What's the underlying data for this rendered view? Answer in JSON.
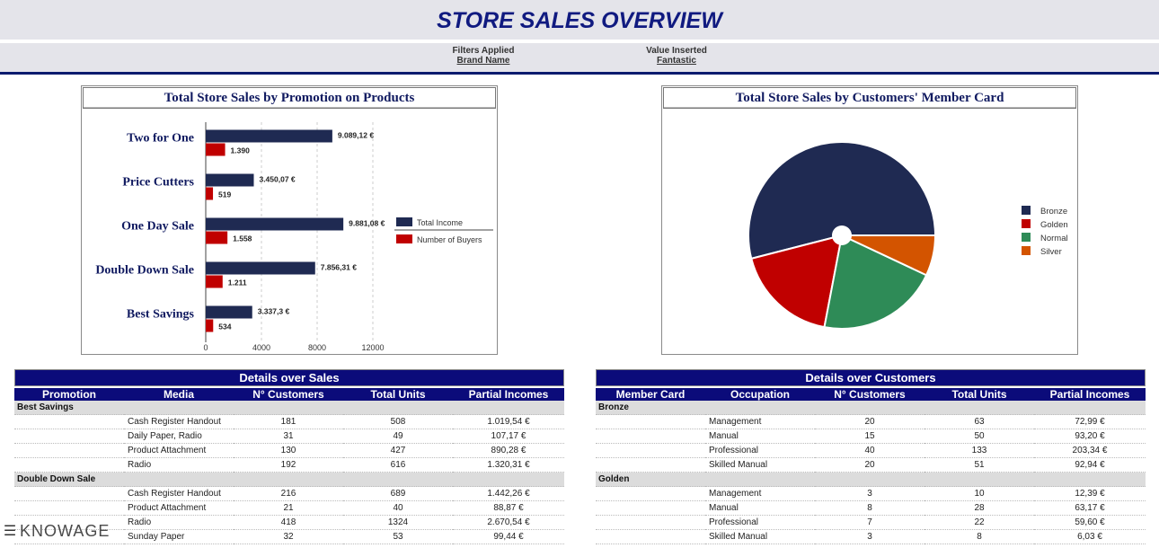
{
  "header": {
    "title": "STORE SALES OVERVIEW"
  },
  "filters": [
    {
      "label": "Filters Applied",
      "value": "Brand Name"
    },
    {
      "label": "Value Inserted",
      "value": "Fantastic"
    }
  ],
  "charts": {
    "promotion": {
      "title": "Total Store Sales by Promotion on Products"
    },
    "member": {
      "title": "Total Store Sales by Customers' Member Card"
    }
  },
  "chart_data": [
    {
      "type": "bar",
      "orientation": "horizontal",
      "title": "Total Store Sales by Promotion on Products",
      "categories": [
        "Two for One",
        "Price Cutters",
        "One Day Sale",
        "Double Down Sale",
        "Best Savings"
      ],
      "series": [
        {
          "name": "Total Income",
          "values": [
            9089.12,
            3450.07,
            9881.08,
            7856.31,
            3337.3
          ],
          "labels": [
            "9.089,12 €",
            "3.450,07 €",
            "9.881,08 €",
            "7.856,31 €",
            "3.337,3 €"
          ],
          "color": "#1f2a52"
        },
        {
          "name": "Number of Buyers",
          "values": [
            1390,
            519,
            1558,
            1211,
            534
          ],
          "labels": [
            "1.390",
            "519",
            "1.558",
            "1.211",
            "534"
          ],
          "color": "#c00000"
        }
      ],
      "xticks": [
        "0",
        "4000",
        "8000",
        "12000"
      ],
      "xlim": [
        0,
        12000
      ],
      "legend": "right"
    },
    {
      "type": "pie",
      "title": "Total Store Sales by Customers' Member Card",
      "categories": [
        "Bronze",
        "Golden",
        "Normal",
        "Silver"
      ],
      "values": [
        54,
        18,
        21,
        7
      ],
      "colors": [
        "#1f2a52",
        "#c00000",
        "#2e8b57",
        "#d35400"
      ],
      "legend": "right"
    }
  ],
  "tables": {
    "sales": {
      "title": "Details over Sales",
      "columns": [
        "Promotion",
        "Media",
        "N° Customers",
        "Total Units",
        "Partial Incomes"
      ],
      "groups": [
        {
          "name": "Best Savings",
          "rows": [
            [
              "Cash Register Handout",
              "181",
              "508",
              "1.019,54 €"
            ],
            [
              "Daily Paper, Radio",
              "31",
              "49",
              "107,17 €"
            ],
            [
              "Product Attachment",
              "130",
              "427",
              "890,28 €"
            ],
            [
              "Radio",
              "192",
              "616",
              "1.320,31 €"
            ]
          ]
        },
        {
          "name": "Double Down Sale",
          "rows": [
            [
              "Cash Register Handout",
              "216",
              "689",
              "1.442,26 €"
            ],
            [
              "Product Attachment",
              "21",
              "40",
              "88,87 €"
            ],
            [
              "Radio",
              "418",
              "1324",
              "2.670,54 €"
            ],
            [
              "Sunday Paper",
              "32",
              "53",
              "99,44 €"
            ]
          ]
        }
      ]
    },
    "customers": {
      "title": "Details over Customers",
      "columns": [
        "Member Card",
        "Occupation",
        "N° Customers",
        "Total Units",
        "Partial Incomes"
      ],
      "groups": [
        {
          "name": "Bronze",
          "rows": [
            [
              "Management",
              "20",
              "63",
              "72,99 €"
            ],
            [
              "Manual",
              "15",
              "50",
              "93,20 €"
            ],
            [
              "Professional",
              "40",
              "133",
              "203,34 €"
            ],
            [
              "Skilled Manual",
              "20",
              "51",
              "92,94 €"
            ]
          ]
        },
        {
          "name": "Golden",
          "rows": [
            [
              "Management",
              "3",
              "10",
              "12,39 €"
            ],
            [
              "Manual",
              "8",
              "28",
              "63,17 €"
            ],
            [
              "Professional",
              "7",
              "22",
              "59,60 €"
            ],
            [
              "Skilled Manual",
              "3",
              "8",
              "6,03 €"
            ]
          ]
        }
      ]
    }
  },
  "footer": {
    "brand": "KNOWAGE",
    "menu_icon": "hamburger-menu-icon"
  }
}
